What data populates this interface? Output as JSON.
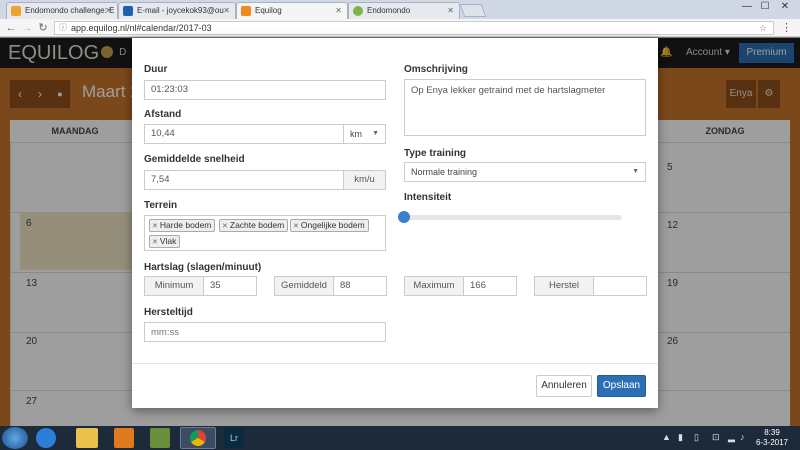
{
  "browser": {
    "tabs": [
      {
        "label": "Endomondo challenge: E",
        "active": false,
        "fav_color": "#f0a030"
      },
      {
        "label": "E-mail - joycekok93@ou",
        "active": false,
        "fav_color": "#1f5fb0"
      },
      {
        "label": "Equilog",
        "active": true,
        "fav_color": "#f08a20"
      },
      {
        "label": "Endomondo",
        "active": false,
        "fav_color": "#7ab648"
      }
    ],
    "url": "app.equilog.nl/nl#calendar/2017-03",
    "window_controls": {
      "min": "—",
      "max": "☐",
      "close": "✕"
    }
  },
  "app": {
    "logo": "EQUILOG",
    "logo_suffix": "D",
    "nav_account": "Account",
    "nav_premium": "Premium",
    "month_title": "Maart 2",
    "horse_name": "Enya",
    "weekday_left": "MAANDAG",
    "weekday_right": "ZONDAG",
    "days_left": [
      "6",
      "13",
      "20",
      "27"
    ],
    "days_right": [
      "5",
      "12",
      "19",
      "26"
    ]
  },
  "modal": {
    "duur": {
      "label": "Duur",
      "value": "01:23:03"
    },
    "afstand": {
      "label": "Afstand",
      "value": "10,44",
      "unit": "km"
    },
    "snelheid": {
      "label": "Gemiddelde snelheid",
      "value": "7,54",
      "unit": "km/u"
    },
    "terrein": {
      "label": "Terrein",
      "tags": [
        "Harde bodem",
        "Zachte bodem",
        "Ongelijke bodem",
        "Vlak"
      ]
    },
    "omschrijving": {
      "label": "Omschrijving",
      "value": "Op Enya lekker getraind met de hartslagmeter"
    },
    "type_training": {
      "label": "Type training",
      "value": "Normale training"
    },
    "intensiteit": {
      "label": "Intensiteit",
      "level_fraction": 0
    },
    "hartslag": {
      "label": "Hartslag (slagen/minuut)",
      "minimum": {
        "label": "Minimum",
        "value": "35"
      },
      "gemiddeld": {
        "label": "Gemiddeld",
        "value": "88"
      },
      "maximum": {
        "label": "Maximum",
        "value": "166"
      },
      "herstel": {
        "label": "Herstel",
        "value": ""
      }
    },
    "hersteltijd": {
      "label": "Hersteltijd",
      "placeholder": "mm:ss"
    },
    "cancel_label": "Annuleren",
    "save_label": "Opslaan"
  },
  "taskbar": {
    "time": "8:39",
    "date": "6-3-2017",
    "apps": [
      {
        "name": "ie-icon",
        "color": "#2b7fd6"
      },
      {
        "name": "explorer-icon",
        "color": "#e8c24a"
      },
      {
        "name": "media-player-icon",
        "color": "#e07a1f"
      },
      {
        "name": "app-icon",
        "color": "#6a8f3a"
      },
      {
        "name": "chrome-icon",
        "color": "#dfe3e8"
      },
      {
        "name": "lightroom-icon",
        "color": "#0b2a3d"
      }
    ],
    "lightroom_label": "Lr"
  }
}
